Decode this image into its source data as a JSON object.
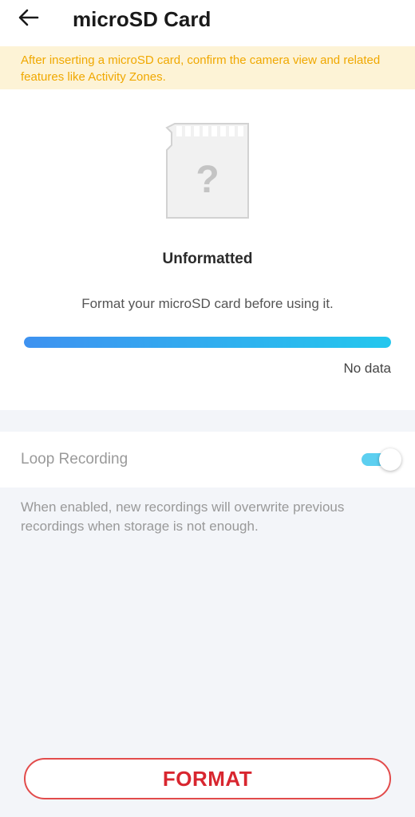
{
  "header": {
    "title": "microSD Card",
    "back_icon": "arrow-left-icon"
  },
  "banner": {
    "text": "After inserting a microSD card, confirm the camera view and related features like Activity Zones.",
    "color": "#f0a800",
    "background": "#fdf3d6"
  },
  "storage": {
    "icon": "sd-card-unknown-icon",
    "status_title": "Unformatted",
    "description": "Format your microSD card before using it.",
    "progress_fraction": 1.0,
    "progress_note": "No data"
  },
  "loop_recording": {
    "label": "Loop Recording",
    "enabled": true,
    "description": "When enabled, new recordings will overwrite previous recordings when storage is not enough."
  },
  "actions": {
    "format_label": "FORMAT",
    "accent": "#d8262f"
  }
}
